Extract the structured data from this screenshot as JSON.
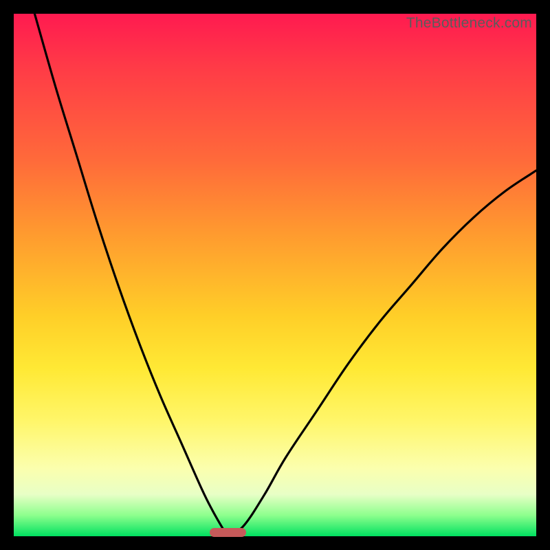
{
  "watermark": "TheBottleneck.com",
  "chart_data": {
    "type": "line",
    "title": "",
    "xlabel": "",
    "ylabel": "",
    "xlim": [
      0,
      100
    ],
    "ylim": [
      0,
      100
    ],
    "grid": false,
    "legend": false,
    "optimum_x": 41,
    "marker": {
      "x": 41,
      "y": 0,
      "width_pct": 7,
      "color": "#c65a5a"
    },
    "gradient_stops": [
      {
        "pct": 0,
        "color": "#ff1a50"
      },
      {
        "pct": 28,
        "color": "#ff6a3a"
      },
      {
        "pct": 58,
        "color": "#ffcf28"
      },
      {
        "pct": 87,
        "color": "#fbffae"
      },
      {
        "pct": 100,
        "color": "#00e060"
      }
    ],
    "series": [
      {
        "name": "left-branch",
        "x": [
          4,
          8,
          12,
          16,
          20,
          24,
          28,
          32,
          36,
          38,
          40,
          41
        ],
        "values": [
          100,
          86,
          73,
          60,
          48,
          37,
          27,
          18,
          9,
          5,
          1.5,
          0
        ]
      },
      {
        "name": "right-branch",
        "x": [
          41,
          44,
          48,
          52,
          58,
          64,
          70,
          76,
          82,
          88,
          94,
          100
        ],
        "values": [
          0,
          2,
          8,
          15,
          24,
          33,
          41,
          48,
          55,
          61,
          66,
          70
        ]
      }
    ]
  }
}
